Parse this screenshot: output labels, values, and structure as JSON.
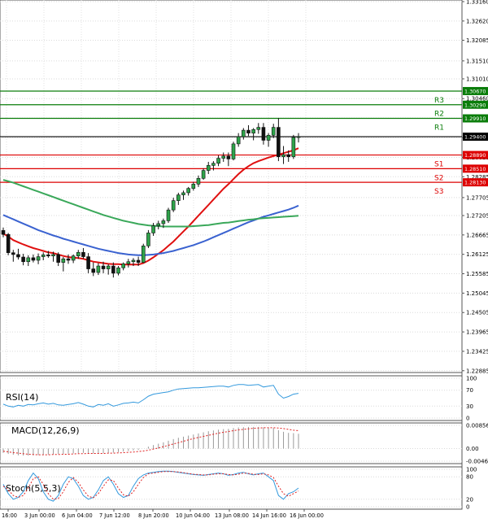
{
  "chart_data": [
    {
      "type": "candlestick",
      "panel": "price",
      "ylim": [
        1.2288,
        1.3316
      ],
      "y_ticks": [
        "1.33160",
        "1.32620",
        "1.32085",
        "1.31510",
        "1.31010",
        "1.30460",
        "1.29920",
        "1.29375",
        "1.28825",
        "1.28285",
        "1.27705",
        "1.27205",
        "1.26665",
        "1.26125",
        "1.25585",
        "1.25045",
        "1.24505",
        "1.23965",
        "1.23425",
        "1.22885"
      ],
      "levels": [
        {
          "name": "R3",
          "value": 1.3067,
          "label": "1.30670",
          "color": "#0a7d0a"
        },
        {
          "name": "R2",
          "value": 1.3029,
          "label": "1.30290",
          "color": "#0a7d0a"
        },
        {
          "name": "R1",
          "value": 1.2991,
          "label": "1.29910",
          "color": "#0a7d0a"
        },
        {
          "name": "",
          "value": 1.294,
          "label": "1.29400",
          "color": "#000000"
        },
        {
          "name": "S1",
          "value": 1.2889,
          "label": "1.28890",
          "color": "#dd0000"
        },
        {
          "name": "S2",
          "value": 1.2851,
          "label": "1.28510",
          "color": "#dd0000"
        },
        {
          "name": "S3",
          "value": 1.2813,
          "label": "1.28130",
          "color": "#dd0000"
        }
      ],
      "candles": [
        [
          1.2679,
          1.2687,
          1.266,
          1.2668
        ],
        [
          1.2668,
          1.2672,
          1.261,
          1.2617
        ],
        [
          1.2617,
          1.2625,
          1.2592,
          1.2612
        ],
        [
          1.2612,
          1.2628,
          1.2598,
          1.2605
        ],
        [
          1.2605,
          1.2614,
          1.2582,
          1.2592
        ],
        [
          1.2592,
          1.261,
          1.258,
          1.2603
        ],
        [
          1.2603,
          1.2612,
          1.259,
          1.2596
        ],
        [
          1.2596,
          1.2615,
          1.2585,
          1.2606
        ],
        [
          1.2606,
          1.2618,
          1.2596,
          1.2611
        ],
        [
          1.2611,
          1.2622,
          1.2603,
          1.2608
        ],
        [
          1.2608,
          1.262,
          1.2592,
          1.2612
        ],
        [
          1.2612,
          1.2618,
          1.258,
          1.259
        ],
        [
          1.259,
          1.2605,
          1.2565,
          1.26
        ],
        [
          1.26,
          1.2612,
          1.2586,
          1.2596
        ],
        [
          1.2596,
          1.2612,
          1.2588,
          1.2608
        ],
        [
          1.2608,
          1.2625,
          1.26,
          1.2618
        ],
        [
          1.2618,
          1.263,
          1.26,
          1.2606
        ],
        [
          1.2606,
          1.2616,
          1.256,
          1.2572
        ],
        [
          1.2572,
          1.259,
          1.2552,
          1.2562
        ],
        [
          1.2562,
          1.2588,
          1.2555,
          1.258
        ],
        [
          1.258,
          1.2592,
          1.256,
          1.2572
        ],
        [
          1.2572,
          1.2585,
          1.2556,
          1.258
        ],
        [
          1.258,
          1.259,
          1.2548,
          1.256
        ],
        [
          1.256,
          1.258,
          1.2554,
          1.2575
        ],
        [
          1.2575,
          1.259,
          1.2568,
          1.2586
        ],
        [
          1.2586,
          1.26,
          1.2576,
          1.2592
        ],
        [
          1.2592,
          1.2602,
          1.258,
          1.2596
        ],
        [
          1.2596,
          1.2606,
          1.258,
          1.259
        ],
        [
          1.259,
          1.2642,
          1.2588,
          1.2636
        ],
        [
          1.2636,
          1.268,
          1.263,
          1.2672
        ],
        [
          1.2672,
          1.27,
          1.2664,
          1.2692
        ],
        [
          1.2692,
          1.2706,
          1.2682,
          1.2698
        ],
        [
          1.2698,
          1.2712,
          1.2686,
          1.2706
        ],
        [
          1.2706,
          1.2742,
          1.27,
          1.2736
        ],
        [
          1.2736,
          1.277,
          1.273,
          1.2762
        ],
        [
          1.2762,
          1.2784,
          1.275,
          1.2778
        ],
        [
          1.2778,
          1.279,
          1.2764,
          1.2784
        ],
        [
          1.2784,
          1.28,
          1.2776,
          1.2796
        ],
        [
          1.2796,
          1.2814,
          1.279,
          1.2808
        ],
        [
          1.2808,
          1.2832,
          1.28,
          1.2824
        ],
        [
          1.2824,
          1.2852,
          1.282,
          1.2846
        ],
        [
          1.2846,
          1.287,
          1.2836,
          1.286
        ],
        [
          1.286,
          1.2872,
          1.2846,
          1.2866
        ],
        [
          1.2866,
          1.2888,
          1.2858,
          1.288
        ],
        [
          1.288,
          1.2896,
          1.287,
          1.2886
        ],
        [
          1.2886,
          1.2896,
          1.2858,
          1.2878
        ],
        [
          1.2878,
          1.2926,
          1.2874,
          1.292
        ],
        [
          1.292,
          1.295,
          1.2912,
          1.294
        ],
        [
          1.294,
          1.2964,
          1.2932,
          1.2958
        ],
        [
          1.2958,
          1.2972,
          1.2942,
          1.295
        ],
        [
          1.295,
          1.2964,
          1.293,
          1.296
        ],
        [
          1.296,
          1.2978,
          1.2948,
          1.2966
        ],
        [
          1.2966,
          1.2978,
          1.2918,
          1.293
        ],
        [
          1.293,
          1.295,
          1.2912,
          1.2944
        ],
        [
          1.2944,
          1.2976,
          1.2936,
          1.2966
        ],
        [
          1.2966,
          1.2992,
          1.2872,
          1.2884
        ],
        [
          1.2884,
          1.2914,
          1.2864,
          1.289
        ],
        [
          1.289,
          1.2902,
          1.287,
          1.2884
        ],
        [
          1.2884,
          1.2945,
          1.2878,
          1.2938
        ],
        [
          1.2938,
          1.295,
          1.2924,
          1.294
        ]
      ],
      "moving_averages": [
        {
          "color": "#e01010",
          "values": [
            1.267,
            1.2662,
            1.2652,
            1.2646,
            1.264,
            1.2635,
            1.263,
            1.2626,
            1.2622,
            1.2618,
            1.2616,
            1.2612,
            1.2608,
            1.2605,
            1.2603,
            1.2602,
            1.26,
            1.2596,
            1.2592,
            1.259,
            1.2588,
            1.2586,
            1.2585,
            1.2585,
            1.2584,
            1.2584,
            1.2584,
            1.2584,
            1.2588,
            1.2595,
            1.2604,
            1.2614,
            1.2624,
            1.2636,
            1.2648,
            1.2662,
            1.2676,
            1.269,
            1.2705,
            1.272,
            1.2735,
            1.275,
            1.2765,
            1.278,
            1.2795,
            1.2808,
            1.2822,
            1.2836,
            1.2848,
            1.2858,
            1.2866,
            1.2872,
            1.2877,
            1.2882,
            1.2886,
            1.289,
            1.2894,
            1.2898,
            1.2902,
            1.2908
          ]
        },
        {
          "color": "#3a62d0",
          "values": [
            1.2722,
            1.2716,
            1.271,
            1.2704,
            1.2698,
            1.2692,
            1.2686,
            1.268,
            1.2675,
            1.267,
            1.2665,
            1.2661,
            1.2656,
            1.2652,
            1.2648,
            1.2644,
            1.264,
            1.2636,
            1.2632,
            1.2628,
            1.2625,
            1.2622,
            1.2619,
            1.2616,
            1.2614,
            1.2612,
            1.2611,
            1.261,
            1.261,
            1.2611,
            1.2612,
            1.2614,
            1.2616,
            1.2619,
            1.2622,
            1.2626,
            1.263,
            1.2634,
            1.2638,
            1.2643,
            1.2648,
            1.2654,
            1.266,
            1.2666,
            1.2672,
            1.2678,
            1.2684,
            1.269,
            1.2696,
            1.2702,
            1.2707,
            1.2712,
            1.2717,
            1.2721,
            1.2725,
            1.2729,
            1.2733,
            1.2737,
            1.2742,
            1.2748
          ]
        },
        {
          "color": "#3aa85a",
          "values": [
            1.282,
            1.2816,
            1.2812,
            1.2807,
            1.2802,
            1.2797,
            1.2792,
            1.2787,
            1.2782,
            1.2777,
            1.2772,
            1.2767,
            1.2762,
            1.2757,
            1.2752,
            1.2747,
            1.2742,
            1.2737,
            1.2732,
            1.2727,
            1.2722,
            1.2718,
            1.2714,
            1.271,
            1.2706,
            1.2703,
            1.27,
            1.2697,
            1.2695,
            1.2693,
            1.2692,
            1.2691,
            1.269,
            1.269,
            1.269,
            1.269,
            1.269,
            1.269,
            1.2691,
            1.2692,
            1.2693,
            1.2694,
            1.2696,
            1.2698,
            1.27,
            1.2701,
            1.2703,
            1.2705,
            1.2707,
            1.2709,
            1.271,
            1.2712,
            1.2713,
            1.2714,
            1.2715,
            1.2716,
            1.2717,
            1.2718,
            1.2719,
            1.272
          ]
        }
      ]
    },
    {
      "type": "line",
      "panel": "rsi",
      "title": "RSI(14)",
      "ylim": [
        0,
        100
      ],
      "y_ticks": [
        "100",
        "70",
        "30",
        "0"
      ],
      "series": [
        {
          "color": "#3399dd",
          "values": [
            35,
            30,
            28,
            32,
            30,
            34,
            33,
            36,
            38,
            35,
            37,
            33,
            32,
            34,
            36,
            39,
            35,
            30,
            28,
            34,
            32,
            36,
            30,
            33,
            37,
            38,
            40,
            38,
            46,
            55,
            60,
            62,
            64,
            66,
            70,
            73,
            74,
            75,
            76,
            76,
            77,
            78,
            79,
            80,
            80,
            78,
            82,
            84,
            84,
            82,
            83,
            84,
            78,
            80,
            82,
            60,
            50,
            54,
            60,
            62
          ]
        }
      ]
    },
    {
      "type": "bar",
      "panel": "macd",
      "title": "MACD(12,26,9)",
      "ylim": [
        -0.004669,
        0.008565
      ],
      "y_ticks": [
        "0.008565",
        "0.00",
        "-0.004669"
      ],
      "histogram": [
        -0.0016,
        -0.002,
        -0.0023,
        -0.0025,
        -0.0026,
        -0.0026,
        -0.0025,
        -0.0024,
        -0.0023,
        -0.0022,
        -0.0021,
        -0.002,
        -0.002,
        -0.0019,
        -0.0018,
        -0.0017,
        -0.0016,
        -0.0017,
        -0.0018,
        -0.0018,
        -0.0017,
        -0.0016,
        -0.0015,
        -0.0013,
        -0.0011,
        -0.0009,
        -0.0007,
        -0.0005,
        0.0,
        0.0007,
        0.0013,
        0.0018,
        0.0023,
        0.0029,
        0.0035,
        0.004,
        0.0044,
        0.0048,
        0.0052,
        0.0056,
        0.006,
        0.0064,
        0.0067,
        0.007,
        0.0072,
        0.0073,
        0.0076,
        0.0078,
        0.0079,
        0.008,
        0.008,
        0.008,
        0.0078,
        0.0077,
        0.0076,
        0.0068,
        0.0062,
        0.0058,
        0.0057,
        0.0055
      ],
      "signal": {
        "color": "#e02020",
        "values": [
          -0.001,
          -0.0012,
          -0.0015,
          -0.0017,
          -0.0019,
          -0.0021,
          -0.0022,
          -0.0023,
          -0.0023,
          -0.0023,
          -0.0022,
          -0.0022,
          -0.0021,
          -0.0021,
          -0.002,
          -0.0019,
          -0.0019,
          -0.0018,
          -0.0018,
          -0.0018,
          -0.0018,
          -0.0017,
          -0.0017,
          -0.0016,
          -0.0015,
          -0.0014,
          -0.0013,
          -0.0011,
          -0.0009,
          -0.0006,
          -0.0002,
          0.0002,
          0.0007,
          0.0012,
          0.0017,
          0.0022,
          0.0027,
          0.0032,
          0.0037,
          0.0041,
          0.0045,
          0.0049,
          0.0053,
          0.0057,
          0.006,
          0.0063,
          0.0066,
          0.0069,
          0.0071,
          0.0073,
          0.0075,
          0.0076,
          0.0077,
          0.0077,
          0.0077,
          0.0076,
          0.0074,
          0.0071,
          0.0068,
          0.0066
        ]
      }
    },
    {
      "type": "line",
      "panel": "stoch",
      "title": "Stoch(5,5,3)",
      "ylim": [
        0,
        100
      ],
      "y_ticks": [
        "100",
        "80",
        "20",
        "0"
      ],
      "series": [
        {
          "color": "#3399dd",
          "values": [
            60,
            35,
            20,
            25,
            40,
            70,
            90,
            75,
            40,
            20,
            15,
            30,
            60,
            80,
            75,
            55,
            30,
            20,
            25,
            45,
            70,
            80,
            60,
            35,
            25,
            30,
            55,
            75,
            85,
            90,
            92,
            94,
            95,
            95,
            94,
            92,
            90,
            88,
            86,
            85,
            84,
            86,
            88,
            90,
            88,
            84,
            86,
            90,
            92,
            88,
            85,
            88,
            90,
            80,
            70,
            30,
            20,
            35,
            40,
            50
          ]
        },
        {
          "color": "#e02020",
          "values": [
            55,
            45,
            30,
            25,
            30,
            50,
            75,
            80,
            60,
            35,
            20,
            22,
            40,
            65,
            78,
            65,
            45,
            28,
            24,
            35,
            55,
            72,
            70,
            50,
            32,
            28,
            40,
            60,
            78,
            88,
            90,
            92,
            94,
            94,
            94,
            93,
            91,
            89,
            87,
            86,
            85,
            85,
            87,
            88,
            88,
            86,
            85,
            87,
            90,
            89,
            87,
            86,
            88,
            85,
            78,
            55,
            35,
            28,
            35,
            42
          ]
        }
      ]
    }
  ],
  "x_axis": {
    "labels": [
      "31 May 16:00",
      "3 Jun 00:00",
      "6 Jun 04:00",
      "7 Jun 12:00",
      "8 Jun 20:00",
      "10 Jun 04:00",
      "13 Jun 08:00",
      "14 Jun 16:00",
      "16 Jun 00:00"
    ],
    "first_label_visible": "16:00"
  }
}
